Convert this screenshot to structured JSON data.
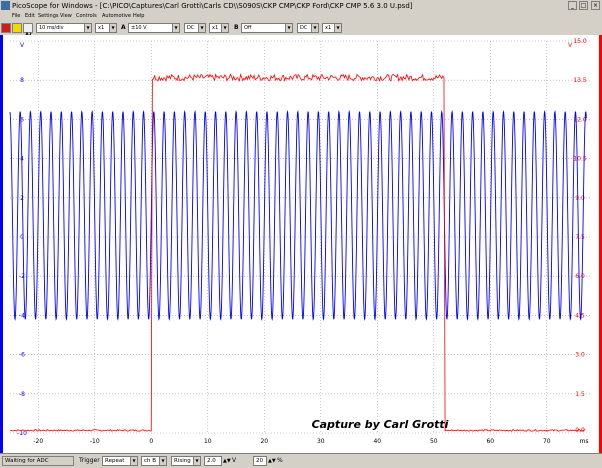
{
  "window": {
    "title": "PicoScope for Windows - [C:\\PICO\\Captures\\Carl Grotti\\Carls CD\\\\S090S\\CKP CMP\\CKP Ford\\CKP CMP 5.6 3.0 U.psd]"
  },
  "menu": [
    "File",
    "Edit",
    "Settings",
    "View",
    "Controls",
    "Automotive",
    "Help"
  ],
  "toolbar": {
    "timebase": "10 ms/div",
    "timebase_mult": "x1",
    "channel_a_label": "A",
    "channel_a_range": "±10 V",
    "channel_a_coupling": "DC",
    "channel_a_mult": "x1",
    "channel_b_label": "B",
    "channel_b_range": "Off",
    "channel_b_coupling": "DC",
    "channel_b_mult": "x1"
  },
  "status_bar": {
    "status": "Waiting for ADC",
    "trigger_label": "Trigger",
    "trigger_mode": "Repeat",
    "trigger_channel": "ch B",
    "trigger_edge": "Rising",
    "trigger_level": "2.0",
    "trigger_level_unit": "V",
    "pretrigger": "20",
    "pretrigger_unit": "%"
  },
  "colors": {
    "channel_a": "#0000ff",
    "channel_b": "#ff0000",
    "grid": "#a0a0a0"
  },
  "chart_data": {
    "type": "line",
    "title": "",
    "x_ticks": [
      "-20",
      "-10",
      "0",
      "10",
      "20",
      "30",
      "40",
      "50",
      "60",
      "70"
    ],
    "x_unit": "ms",
    "xlim": [
      -25,
      78
    ],
    "left_axis": {
      "unit": "V",
      "ticks": [
        "8",
        "6",
        "4",
        "2",
        "0",
        "-2",
        "-4",
        "-6",
        "-8",
        "-10"
      ],
      "ylim": [
        -10,
        10
      ],
      "color": "#0000ff"
    },
    "right_axis": {
      "unit": "V",
      "ticks": [
        "15.0",
        "13.5",
        "12.0",
        "10.5",
        "9.0",
        "7.5",
        "6.0",
        "4.5",
        "3.0",
        "1.5",
        "0.0"
      ],
      "ylim": [
        0,
        15
      ],
      "color": "#ff0000"
    },
    "series": [
      {
        "channel": "A",
        "color": "#0000ff",
        "pattern": "sine",
        "period_ms": 1.82,
        "high_v": 6.4,
        "low_v": -4.2,
        "x_start_ms": -25,
        "x_end_ms": 77
      },
      {
        "channel": "B",
        "color": "#ff0000",
        "pattern": "pulse",
        "low_v": 0.1,
        "high_v": 13.6,
        "rise_ms": 0,
        "fall_ms": 52,
        "x_start_ms": -25,
        "x_end_ms": 77
      }
    ],
    "annotation": "Capture by Carl Grotti"
  }
}
